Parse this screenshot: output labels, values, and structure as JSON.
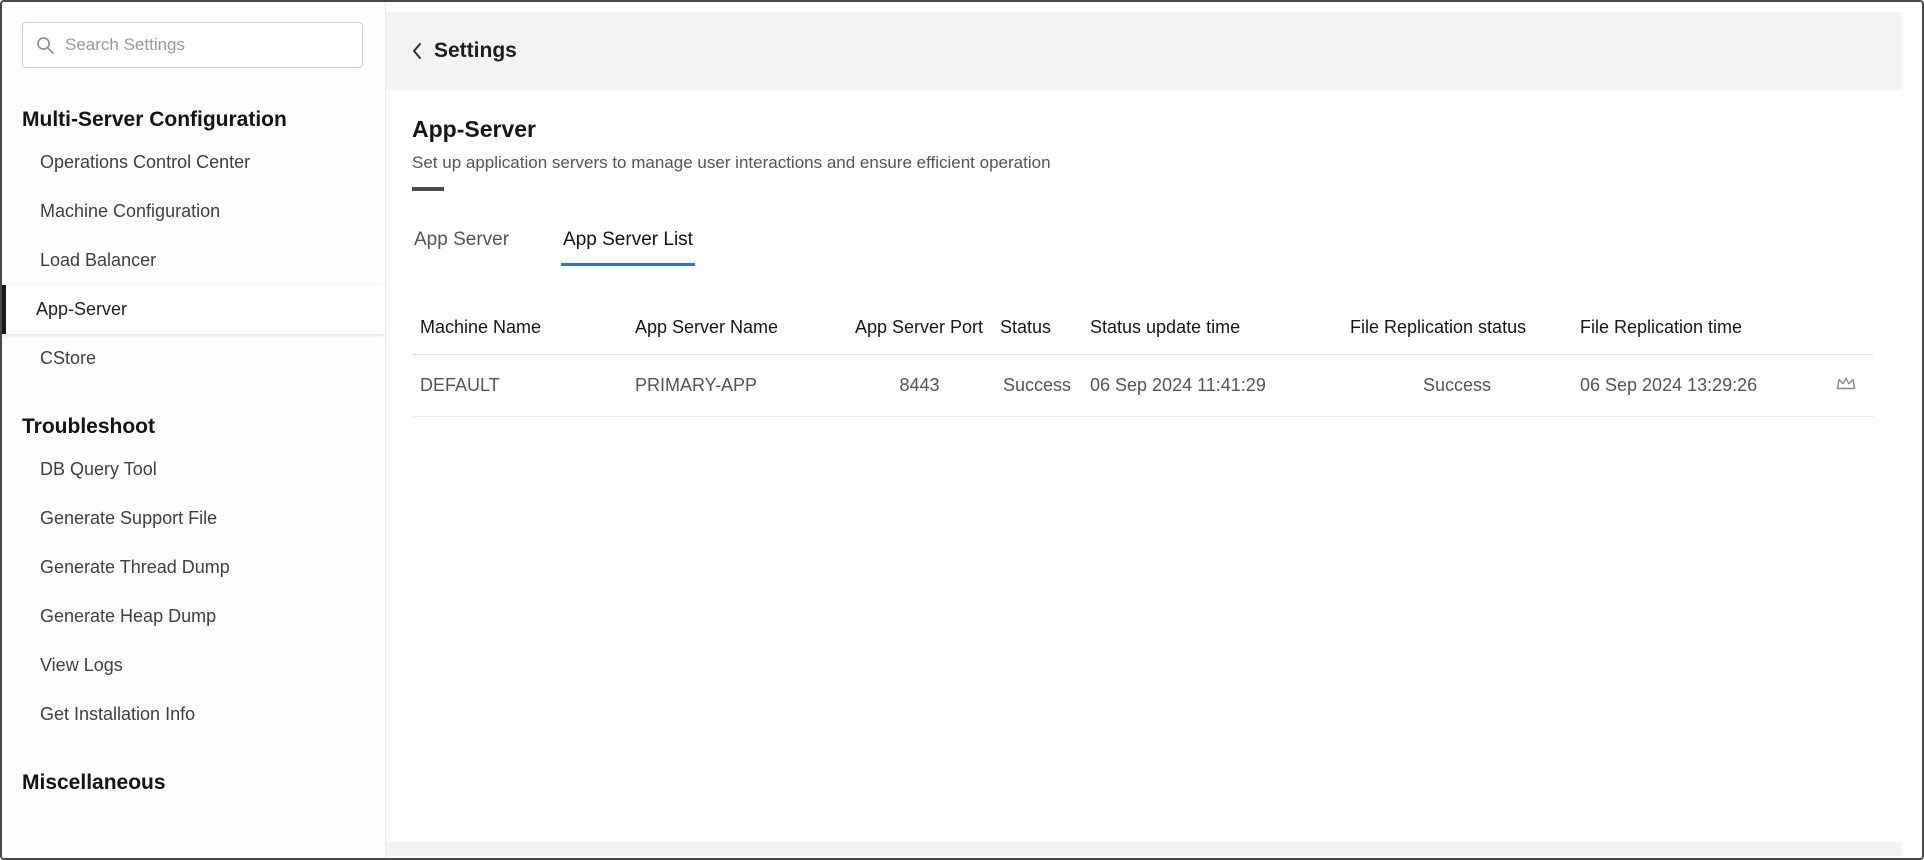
{
  "sidebar": {
    "search": {
      "placeholder": "Search Settings"
    },
    "sections": [
      {
        "title": "Multi-Server Configuration",
        "items": [
          {
            "label": "Operations Control Center"
          },
          {
            "label": "Machine Configuration"
          },
          {
            "label": "Load Balancer"
          },
          {
            "label": "App-Server",
            "selected": true
          },
          {
            "label": "CStore"
          }
        ]
      },
      {
        "title": "Troubleshoot",
        "items": [
          {
            "label": "DB Query Tool"
          },
          {
            "label": "Generate Support File"
          },
          {
            "label": "Generate Thread Dump"
          },
          {
            "label": "Generate Heap Dump"
          },
          {
            "label": "View Logs"
          },
          {
            "label": "Get Installation Info"
          }
        ]
      },
      {
        "title": "Miscellaneous",
        "items": []
      }
    ]
  },
  "header": {
    "back_label": "Settings",
    "back_icon": "chevron-left-icon"
  },
  "main": {
    "title": "App-Server",
    "subtitle": "Set up application servers to manage user interactions and ensure efficient operation",
    "tabs": [
      {
        "label": "App Server",
        "active": false
      },
      {
        "label": "App Server List",
        "active": true
      }
    ],
    "table": {
      "columns": [
        "Machine Name",
        "App Server Name",
        "App Server Port",
        "Status",
        "Status update time",
        "File Replication status",
        "File Replication time"
      ],
      "rows": [
        {
          "machine_name": "DEFAULT",
          "app_server_name": "PRIMARY-APP",
          "app_server_port": "8443",
          "status": "Success",
          "status_update_time": "06 Sep 2024 11:41:29",
          "file_replication_status": "Success",
          "file_replication_time": "06 Sep 2024 13:29:26",
          "row_icon": "crown-icon"
        }
      ]
    }
  },
  "colors": {
    "tab_accent": "#2e6ee0",
    "selected_item_bar": "#1a1a1a",
    "header_band_bg": "#f4f4f4",
    "outer_border": "#484848"
  }
}
